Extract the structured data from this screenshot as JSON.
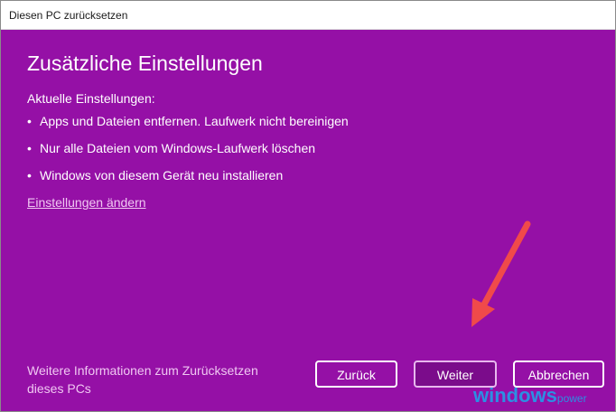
{
  "window": {
    "title": "Diesen PC zurücksetzen"
  },
  "main": {
    "heading": "Zusätzliche Einstellungen",
    "current_settings_label": "Aktuelle Einstellungen:",
    "bullets": [
      "Apps und Dateien entfernen. Laufwerk nicht bereinigen",
      "Nur alle Dateien vom Windows-Laufwerk löschen",
      "Windows von diesem Gerät neu installieren"
    ],
    "bullet_symbol": "•",
    "change_settings_link": "Einstellungen ändern"
  },
  "footer": {
    "more_info_link": "Weitere Informationen zum Zurücksetzen dieses PCs",
    "back_label": "Zurück",
    "next_label": "Weiter",
    "cancel_label": "Abbrechen"
  },
  "watermark": {
    "brand": "windows",
    "suffix": "power"
  },
  "colors": {
    "background": "#9510a6",
    "arrow": "#f04a4a",
    "link": "#f0c7f2",
    "watermark": "#2c8fe3"
  }
}
